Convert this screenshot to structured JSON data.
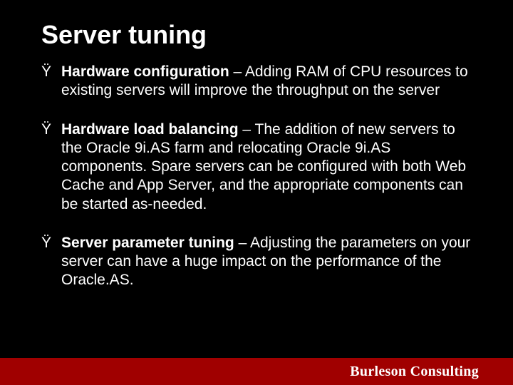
{
  "slide": {
    "title": "Server tuning",
    "bullets": [
      {
        "marker": "Ÿ",
        "bold": "Hardware configuration",
        "rest": " – Adding RAM of CPU resources to existing servers will improve the throughput on the server"
      },
      {
        "marker": "Ÿ",
        "bold": "Hardware load balancing",
        "rest": " – The addition of new servers to the Oracle 9i.AS farm and relocating Oracle 9i.AS components.  Spare servers can be configured with both Web Cache and App Server, and the appropriate components can be started as-needed."
      },
      {
        "marker": "Ÿ",
        "bold": "Server parameter tuning",
        "rest": " – Adjusting the parameters on your server can have a huge impact on the performance of the Oracle.AS."
      }
    ],
    "footer": "Burleson Consulting"
  }
}
